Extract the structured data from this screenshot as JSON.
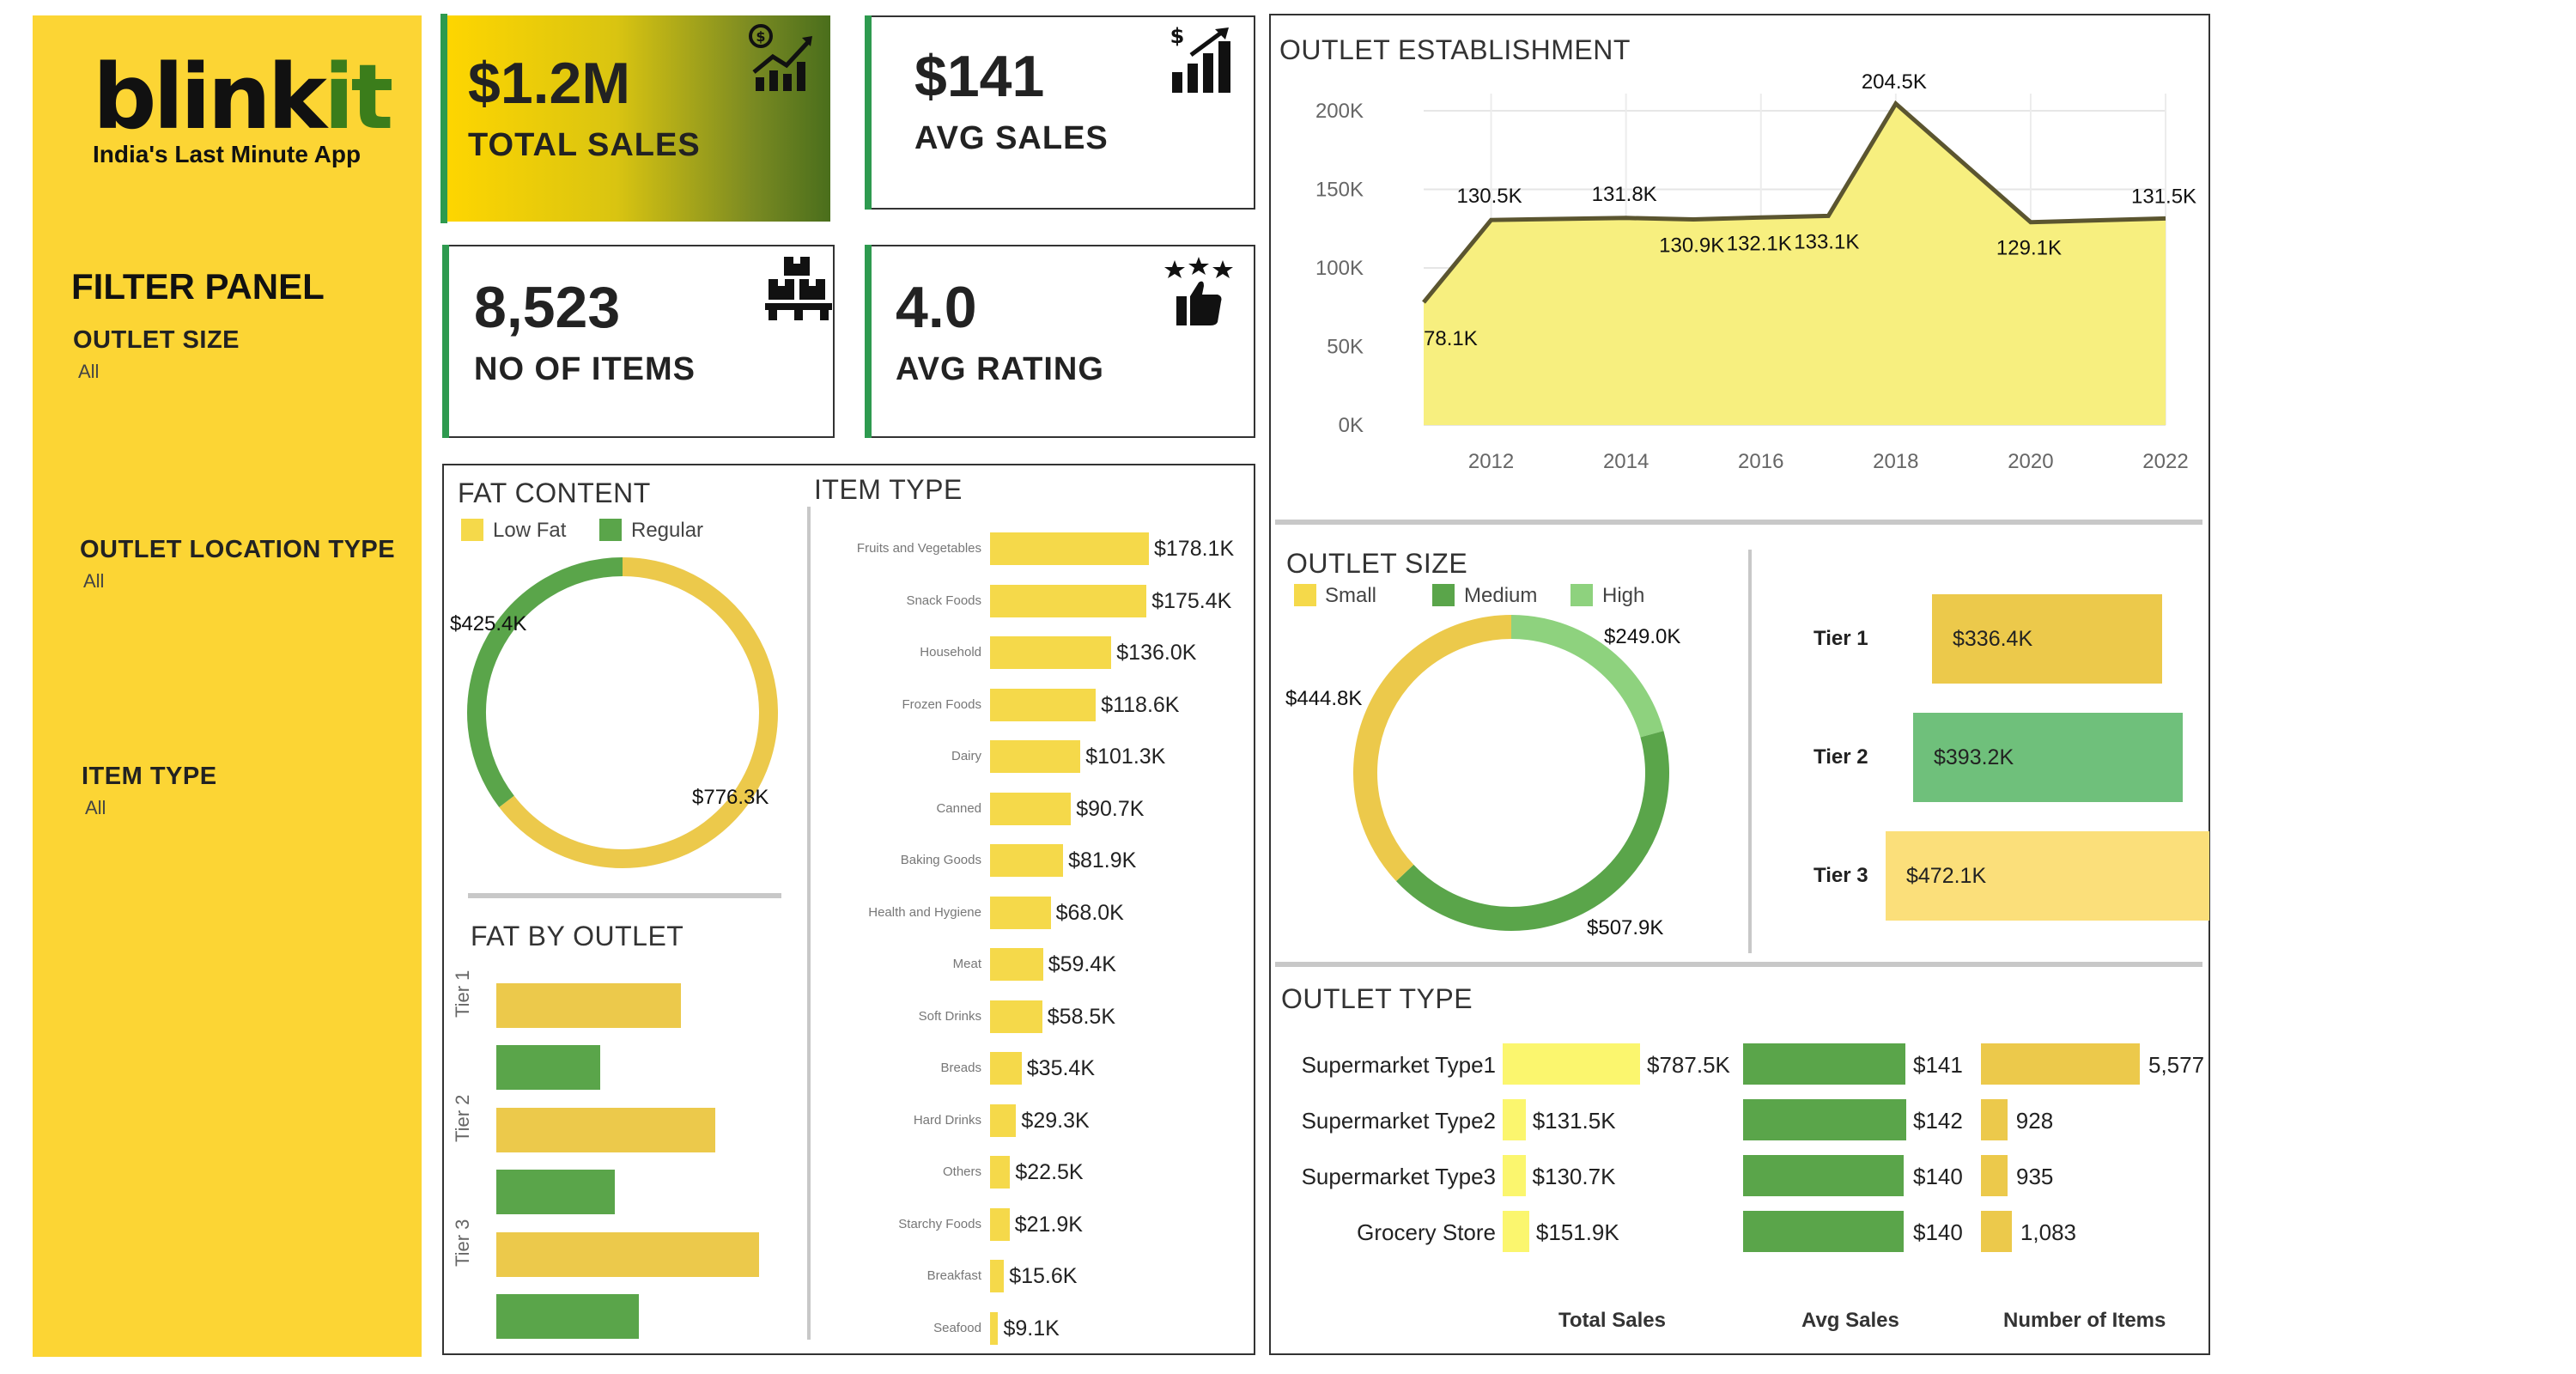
{
  "brand": {
    "logo_main": "blink",
    "logo_accent": "it",
    "tagline": "India's Last Minute App"
  },
  "filter_panel": {
    "title": "FILTER PANEL",
    "filters": [
      {
        "label": "OUTLET SIZE",
        "value": "All"
      },
      {
        "label": "OUTLET LOCATION TYPE",
        "value": "All"
      },
      {
        "label": "ITEM TYPE",
        "value": "All"
      }
    ]
  },
  "kpis": [
    {
      "value": "$1.2M",
      "label": "TOTAL SALES",
      "icon": "sales-chart-icon"
    },
    {
      "value": "$141",
      "label": "AVG SALES",
      "icon": "growth-chart-icon"
    },
    {
      "value": "8,523",
      "label": "NO OF ITEMS",
      "icon": "boxes-icon"
    },
    {
      "value": "4.0",
      "label": "AVG RATING",
      "icon": "thumbs-up-stars-icon"
    }
  ],
  "colors": {
    "yellow": "#f5d94a",
    "dark_yellow": "#ecc94b",
    "green": "#5aa54a",
    "light_green": "#8ed27e",
    "area_fill": "#f7ef7f",
    "line": "#5b5530"
  },
  "chart_data": [
    {
      "type": "area",
      "title": "OUTLET ESTABLISHMENT",
      "x": [
        2011,
        2012,
        2014,
        2015,
        2016,
        2017,
        2018,
        2020,
        2022
      ],
      "y": [
        78.1,
        130.5,
        131.8,
        130.9,
        132.1,
        133.1,
        204.5,
        129.1,
        131.5
      ],
      "labels": [
        "78.1K",
        "130.5K",
        "131.8K",
        "130.9K",
        "132.1K",
        "133.1K",
        "204.5K",
        "129.1K",
        "131.5K"
      ],
      "xticks": [
        "2012",
        "2014",
        "2016",
        "2018",
        "2020",
        "2022"
      ],
      "yticks": [
        "0K",
        "50K",
        "100K",
        "150K",
        "200K"
      ],
      "ylim": [
        0,
        200
      ]
    },
    {
      "type": "pie",
      "title": "FAT CONTENT",
      "legend": [
        "Low Fat",
        "Regular"
      ],
      "values": [
        776.3,
        425.4
      ],
      "labels": [
        "$776.3K",
        "$425.4K"
      ]
    },
    {
      "type": "bar",
      "title": "ITEM TYPE",
      "categories": [
        "Fruits and Vegetables",
        "Snack Foods",
        "Household",
        "Frozen Foods",
        "Dairy",
        "Canned",
        "Baking Goods",
        "Health and Hygiene",
        "Meat",
        "Soft Drinks",
        "Breads",
        "Hard Drinks",
        "Others",
        "Starchy Foods",
        "Breakfast",
        "Seafood"
      ],
      "values": [
        178.1,
        175.4,
        136.0,
        118.6,
        101.3,
        90.7,
        81.9,
        68.0,
        59.4,
        58.5,
        35.4,
        29.3,
        22.5,
        21.9,
        15.6,
        9.1
      ],
      "labels": [
        "$178.1K",
        "$175.4K",
        "$136.0K",
        "$118.6K",
        "$101.3K",
        "$90.7K",
        "$81.9K",
        "$68.0K",
        "$59.4K",
        "$58.5K",
        "$35.4K",
        "$29.3K",
        "$22.5K",
        "$21.9K",
        "$15.6K",
        "$9.1K"
      ]
    },
    {
      "type": "bar",
      "title": "FAT BY OUTLET",
      "categories": [
        "Tier 1",
        "Tier 2",
        "Tier 3"
      ],
      "series": [
        {
          "values": [
            215,
            255,
            306
          ]
        },
        {
          "values": [
            121,
            138,
            166
          ]
        }
      ]
    },
    {
      "type": "pie",
      "title": "OUTLET SIZE",
      "legend": [
        "Small",
        "Medium",
        "High"
      ],
      "values": [
        444.8,
        507.9,
        249.0
      ],
      "labels": [
        "$444.8K",
        "$507.9K",
        "$249.0K"
      ]
    },
    {
      "type": "bar",
      "categories": [
        "Tier 1",
        "Tier 2",
        "Tier 3"
      ],
      "values": [
        336.4,
        393.2,
        472.1
      ],
      "labels": [
        "$336.4K",
        "$393.2K",
        "$472.1K"
      ]
    },
    {
      "type": "table",
      "title": "OUTLET TYPE",
      "rows": [
        "Supermarket Type1",
        "Supermarket Type2",
        "Supermarket Type3",
        "Grocery Store"
      ],
      "columns": [
        "Total Sales",
        "Avg Sales",
        "Number of Items"
      ],
      "total_sales": [
        787.5,
        131.5,
        130.7,
        151.9
      ],
      "total_sales_labels": [
        "$787.5K",
        "$131.5K",
        "$130.7K",
        "$151.9K"
      ],
      "avg_sales": [
        141,
        142,
        140,
        140
      ],
      "avg_sales_labels": [
        "$141",
        "$142",
        "$140",
        "$140"
      ],
      "items": [
        5577,
        928,
        935,
        1083
      ],
      "items_labels": [
        "5,577",
        "928",
        "935",
        "1,083"
      ]
    }
  ]
}
